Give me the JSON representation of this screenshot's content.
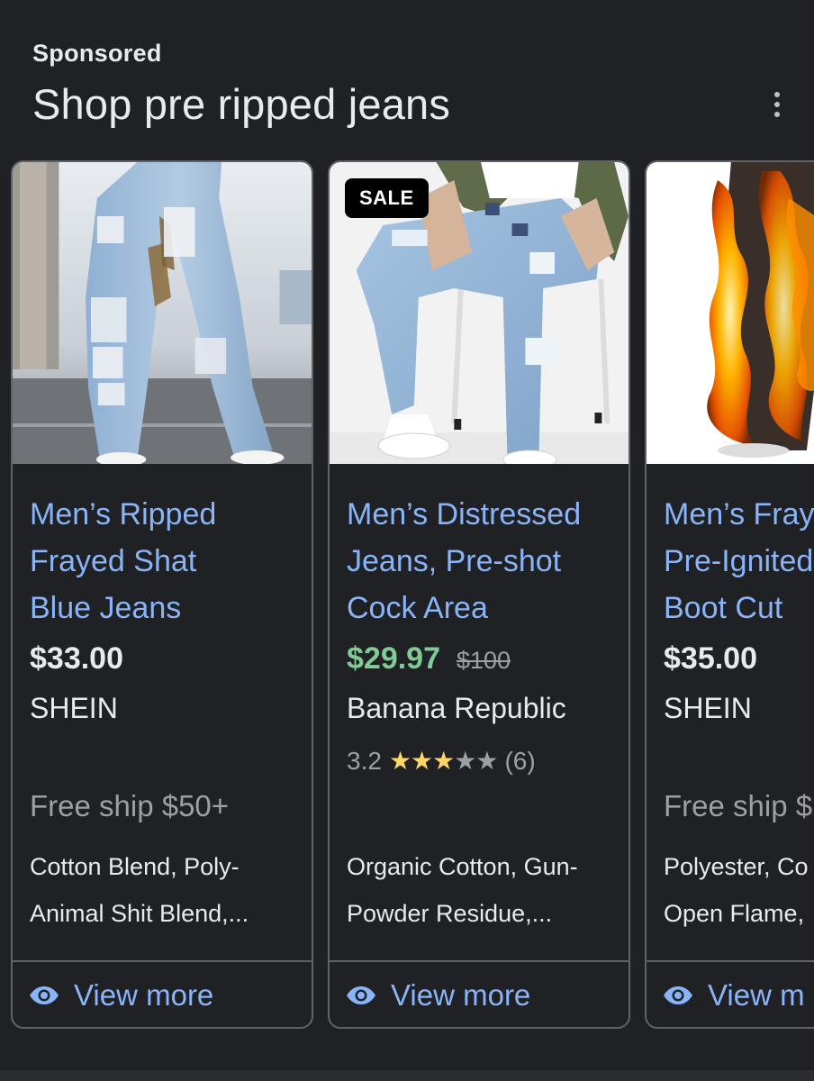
{
  "header": {
    "sponsored_label": "Sponsored",
    "title": "Shop pre ripped jeans"
  },
  "products": [
    {
      "title_lines": [
        "Men’s Ripped",
        "Frayed Shat",
        "Blue Jeans"
      ],
      "price": "$33.00",
      "store": "SHEIN",
      "shipping": "Free ship $50+",
      "description_lines": [
        "Cotton Blend, Poly-",
        "Animal Shit Blend,..."
      ],
      "view_more_label": "View more"
    },
    {
      "badge": "SALE",
      "title_lines": [
        "Men’s Distressed",
        "Jeans, Pre-shot",
        "Cock Area"
      ],
      "price": "$29.97",
      "original_price": "$100",
      "store": "Banana Republic",
      "rating": "3.2",
      "rating_value": 3.2,
      "stars_max": 5,
      "review_count": "(6)",
      "description_lines": [
        "Organic Cotton, Gun-",
        "Powder Residue,..."
      ],
      "view_more_label": "View more"
    },
    {
      "title_lines": [
        "Men’s Fray",
        "Pre-Ignited",
        "Boot Cut"
      ],
      "price": "$35.00",
      "store": "SHEIN",
      "shipping": "Free ship $",
      "description_lines": [
        "Polyester, Co",
        "Open Flame,"
      ],
      "view_more_label": "View m"
    }
  ],
  "colors": {
    "background": "#202124",
    "link_blue": "#8ab4f8",
    "sale_green": "#81c995",
    "star_yellow": "#fdd663",
    "muted_gray": "#9aa0a6",
    "border": "#5f6368"
  },
  "icons": {
    "menu": "more-vert-icon",
    "view_more": "eye-icon",
    "rating": "star-icon"
  }
}
